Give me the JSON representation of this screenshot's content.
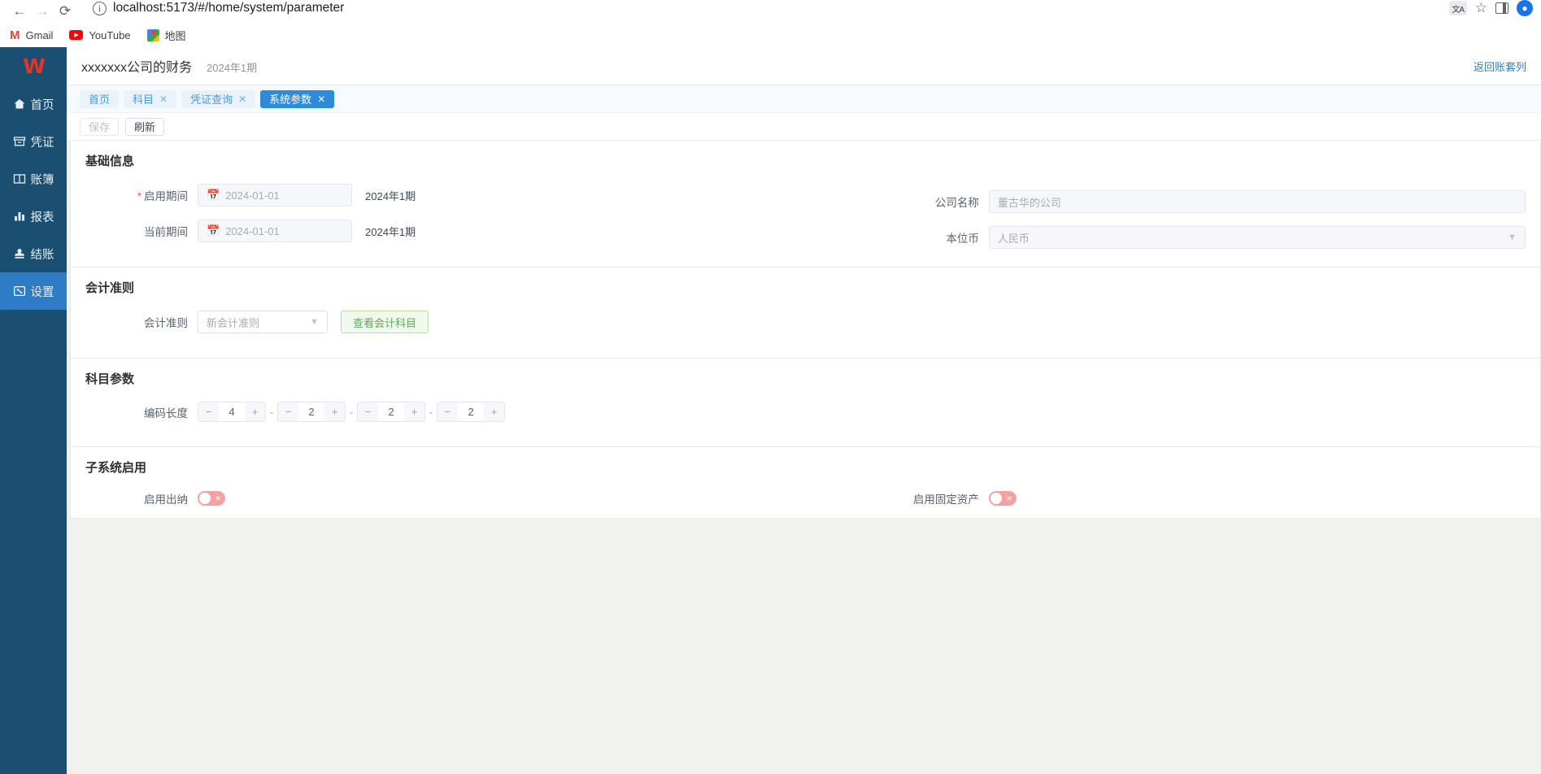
{
  "browser": {
    "url": "localhost:5173/#/home/system/parameter",
    "back_icon": "arrow-left-icon",
    "forward_icon": "arrow-right-icon",
    "reload_icon": "reload-icon",
    "info_icon": "info-circle-icon",
    "translate_icon": "translate-icon",
    "star_icon": "bookmark-star-icon",
    "panel_icon": "side-panel-icon",
    "avatar_icon": "profile-avatar-icon",
    "bookmarks": [
      {
        "label": "Gmail",
        "icon": "gmail-icon"
      },
      {
        "label": "YouTube",
        "icon": "youtube-icon"
      },
      {
        "label": "地图",
        "icon": "google-maps-icon"
      }
    ]
  },
  "sidebar": {
    "logo": "W",
    "items": [
      {
        "label": "首页",
        "icon": "home-icon",
        "active": false
      },
      {
        "label": "凭证",
        "icon": "voucher-box-icon",
        "active": false
      },
      {
        "label": "账簿",
        "icon": "book-icon",
        "active": false
      },
      {
        "label": "报表",
        "icon": "bar-chart-icon",
        "active": false
      },
      {
        "label": "结账",
        "icon": "stamp-icon",
        "active": false
      },
      {
        "label": "设置",
        "icon": "settings-icon",
        "active": true
      }
    ]
  },
  "header": {
    "title": "xxxxxxx公司的财务",
    "period": "2024年1期",
    "back_link": "返回账套列"
  },
  "tabs": [
    {
      "label": "首页",
      "closable": false,
      "active": false
    },
    {
      "label": "科目",
      "closable": true,
      "active": false
    },
    {
      "label": "凭证查询",
      "closable": true,
      "active": false
    },
    {
      "label": "系统参数",
      "closable": true,
      "active": true
    }
  ],
  "toolbar": {
    "save_label": "保存",
    "refresh_label": "刷新"
  },
  "sections": {
    "basic": {
      "title": "基础信息",
      "start_period_label": "启用期间",
      "start_period_value": "2024-01-01",
      "start_period_suffix": "2024年1期",
      "current_period_label": "当前期间",
      "current_period_value": "2024-01-01",
      "current_period_suffix": "2024年1期",
      "company_name_label": "公司名称",
      "company_name_value": "董古华的公司",
      "currency_label": "本位币",
      "currency_value": "人民币"
    },
    "standard": {
      "title": "会计准则",
      "label": "会计准则",
      "value": "新会计准则",
      "view_button": "查看会计科目"
    },
    "subject": {
      "title": "科目参数",
      "label": "编码长度",
      "values": [
        "4",
        "2",
        "2",
        "2"
      ],
      "separator": "-",
      "minus": "−",
      "plus": "+"
    },
    "subsystem": {
      "title": "子系统启用",
      "cashier_label": "启用出纳",
      "cashier_on": false,
      "asset_label": "启用固定资产",
      "asset_on": false
    }
  },
  "colors": {
    "sidebar_bg": "#1b4f72",
    "sidebar_active": "#2e7cc4",
    "logo_red": "#e8332a",
    "tab_active": "#2e8bda",
    "link_blue": "#2e7cc4",
    "switch_off": "#f0a3a3",
    "green_button": "#5cab5c"
  }
}
